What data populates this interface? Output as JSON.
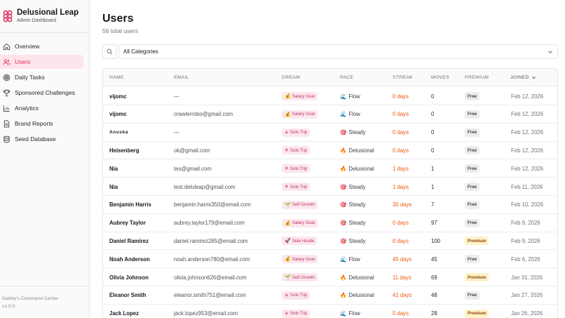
{
  "brand": {
    "name": "Delusional Leap",
    "subtitle": "Admin Dashboard"
  },
  "nav": [
    {
      "label": "Overview",
      "icon": "home-icon",
      "active": false
    },
    {
      "label": "Users",
      "icon": "users-icon",
      "active": true
    },
    {
      "label": "Daily Tasks",
      "icon": "target-icon",
      "active": false
    },
    {
      "label": "Sponsored Challenges",
      "icon": "trophy-icon",
      "active": false
    },
    {
      "label": "Analytics",
      "icon": "chart-icon",
      "active": false
    },
    {
      "label": "Brand Reports",
      "icon": "document-icon",
      "active": false
    },
    {
      "label": "Seed Database",
      "icon": "database-icon",
      "active": false
    }
  ],
  "footer": {
    "line1": "Gabby's Command Center",
    "line2": "v1.0.0"
  },
  "header": {
    "title": "Users",
    "subtitle": "56 total users"
  },
  "filter": {
    "selected": "All Categories"
  },
  "columns": {
    "name": "Name",
    "email": "Email",
    "dream": "Dream",
    "pace": "Pace",
    "streak": "Streak",
    "moves": "Moves",
    "premium": "Premium",
    "joined": "Joined"
  },
  "rows": [
    {
      "name": "vijomc",
      "email": "—",
      "dream": "Salary Goal",
      "dream_icon": "money-bag-icon",
      "pace": "Flow",
      "pace_icon": "wave-icon",
      "streak": "0 days",
      "moves": "0",
      "tier": "Free",
      "joined": "Feb 12, 2026"
    },
    {
      "name": "vijomc",
      "email": "crawlerrobo@gmail.com",
      "dream": "Salary Goal",
      "dream_icon": "money-bag-icon",
      "pace": "Flow",
      "pace_icon": "wave-icon",
      "streak": "0 days",
      "moves": "0",
      "tier": "Free",
      "joined": "Feb 12, 2026"
    },
    {
      "name": "Anuska",
      "email": "—",
      "dream": "Solo Trip",
      "dream_icon": "plane-icon",
      "pace": "Steady",
      "pace_icon": "target-icon",
      "streak": "0 days",
      "moves": "0",
      "tier": "Free",
      "joined": "Feb 12, 2026"
    },
    {
      "name": "Heisenberg",
      "email": "ok@gmail.com",
      "dream": "Solo Trip",
      "dream_icon": "plane-icon",
      "pace": "Delusional",
      "pace_icon": "fire-icon",
      "streak": "0 days",
      "moves": "0",
      "tier": "Free",
      "joined": "Feb 12, 2026"
    },
    {
      "name": "Nia",
      "email": "tes@gmail.com",
      "dream": "Solo Trip",
      "dream_icon": "plane-icon",
      "pace": "Delusional",
      "pace_icon": "fire-icon",
      "streak": "1 days",
      "moves": "1",
      "tier": "Free",
      "joined": "Feb 12, 2026"
    },
    {
      "name": "Nia",
      "email": "test.deluleap@gmail.com",
      "dream": "Solo Trip",
      "dream_icon": "plane-icon",
      "pace": "Steady",
      "pace_icon": "target-icon",
      "streak": "1 days",
      "moves": "1",
      "tier": "Free",
      "joined": "Feb 11, 2026"
    },
    {
      "name": "Benjamin Harris",
      "email": "benjamin.harris350@email.com",
      "dream": "Self Growth",
      "dream_icon": "sprout-icon",
      "pace": "Steady",
      "pace_icon": "target-icon",
      "streak": "30 days",
      "moves": "7",
      "tier": "Free",
      "joined": "Feb 10, 2026"
    },
    {
      "name": "Aubrey Taylor",
      "email": "aubrey.taylor179@email.com",
      "dream": "Salary Goal",
      "dream_icon": "money-bag-icon",
      "pace": "Steady",
      "pace_icon": "target-icon",
      "streak": "0 days",
      "moves": "97",
      "tier": "Free",
      "joined": "Feb 9, 2026"
    },
    {
      "name": "Daniel Ramirez",
      "email": "daniel.ramirez285@email.com",
      "dream": "Side Hustle",
      "dream_icon": "rocket-icon",
      "pace": "Steady",
      "pace_icon": "target-icon",
      "streak": "0 days",
      "moves": "100",
      "tier": "Premium",
      "joined": "Feb 9, 2026"
    },
    {
      "name": "Noah Anderson",
      "email": "noah.anderson780@email.com",
      "dream": "Salary Goal",
      "dream_icon": "money-bag-icon",
      "pace": "Flow",
      "pace_icon": "wave-icon",
      "streak": "45 days",
      "moves": "45",
      "tier": "Free",
      "joined": "Feb 6, 2026"
    },
    {
      "name": "Olivia Johnson",
      "email": "olivia.johnson626@email.com",
      "dream": "Self Growth",
      "dream_icon": "sprout-icon",
      "pace": "Delusional",
      "pace_icon": "fire-icon",
      "streak": "11 days",
      "moves": "69",
      "tier": "Premium",
      "joined": "Jan 31, 2026"
    },
    {
      "name": "Eleanor Smith",
      "email": "eleanor.smith751@email.com",
      "dream": "Solo Trip",
      "dream_icon": "plane-icon",
      "pace": "Delusional",
      "pace_icon": "fire-icon",
      "streak": "41 days",
      "moves": "48",
      "tier": "Free",
      "joined": "Jan 27, 2026"
    },
    {
      "name": "Jack Lopez",
      "email": "jack.lopez953@email.com",
      "dream": "Solo Trip",
      "dream_icon": "plane-icon",
      "pace": "Flow",
      "pace_icon": "wave-icon",
      "streak": "0 days",
      "moves": "28",
      "tier": "Premium",
      "joined": "Jan 26, 2026"
    }
  ],
  "colors": {
    "accent": "#e0335e",
    "streak": "#ea580c",
    "premium_bg": "#fef3c7"
  }
}
